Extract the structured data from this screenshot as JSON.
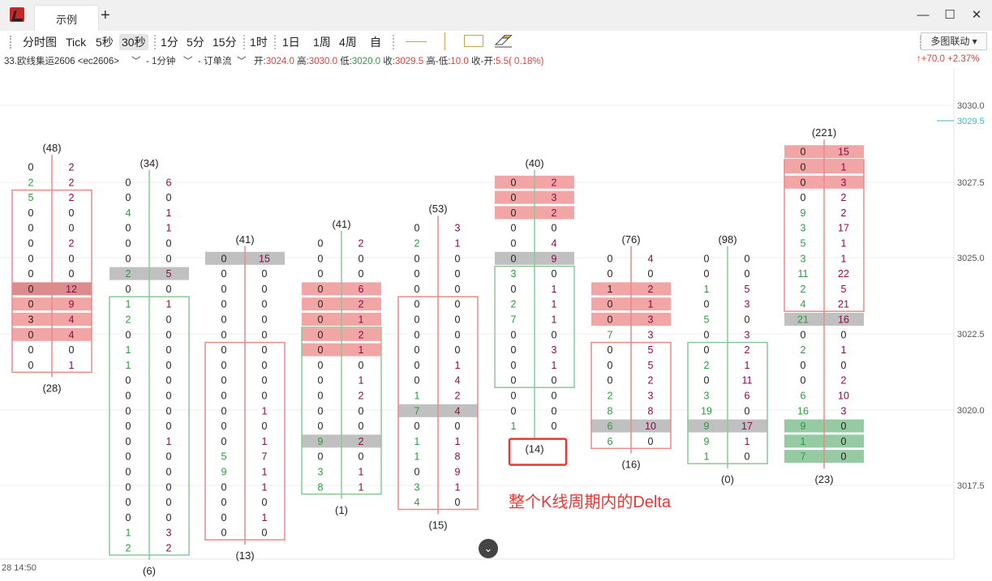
{
  "window": {
    "tab_title": "示例",
    "add_tab": "+",
    "controls": [
      "minimize",
      "maximize",
      "close"
    ]
  },
  "toolbar": {
    "items": [
      "分时图",
      "Tick",
      "5秒",
      "30秒",
      "1分",
      "5分",
      "15分",
      "1时",
      "1日",
      "1周",
      "4周",
      "自"
    ],
    "active": "30秒",
    "sync_label": "多图联动"
  },
  "info": {
    "contract": "33.欧线集运2606 <ec2606>",
    "period": "- 1分钟",
    "mode": "- 订单流",
    "open_label": "开:",
    "open": "3024.0",
    "high_label": "高:",
    "high": "3030.0",
    "low_label": "低:",
    "low": "3020.0",
    "close_label": "收:",
    "close": "3029.5",
    "hl_label": "高-低:",
    "hl": "10.0",
    "co_label": "收-开:",
    "co": "5.5( 0.18%)",
    "change": "↑+70.0 +2.37%"
  },
  "colors": {
    "up": "#e0403a",
    "down": "#2a9d3a",
    "bid": "#222222",
    "ask": "#8b0a4a",
    "box_up": "#e88a8a",
    "box_down": "#8cc79a",
    "hl_red": "#f0a0a0",
    "hl_green": "#8fc79e",
    "hl_gray": "#bdbdbd"
  },
  "chart_data": {
    "type": "footprint",
    "price_axis": {
      "ticks": [
        "3030.0",
        "3027.5",
        "3025.0",
        "3022.5",
        "3020.0",
        "3017.5"
      ],
      "last": "3029.5"
    },
    "time_label": "28 14:50",
    "annotation": "整个K线周期内的Delta",
    "bars": [
      {
        "top_label": "(48)",
        "bottom_label": "(28)",
        "dir": "up",
        "start": 0,
        "body": [
          2,
          14
        ],
        "rows": [
          [
            0,
            2
          ],
          [
            2,
            2
          ],
          [
            5,
            2
          ],
          [
            0,
            0
          ],
          [
            0,
            0
          ],
          [
            0,
            2
          ],
          [
            0,
            0
          ],
          [
            0,
            0
          ],
          [
            0,
            12
          ],
          [
            0,
            9
          ],
          [
            3,
            4
          ],
          [
            0,
            4
          ],
          [
            0,
            0
          ],
          [
            0,
            1
          ]
        ],
        "hl": {
          "8": "d",
          "9": "r",
          "10": "r",
          "11": "r"
        }
      },
      {
        "top_label": "(34)",
        "bottom_label": "(6)",
        "dir": "down",
        "start": 1,
        "body": [
          6,
          25
        ],
        "rows": [
          [
            0,
            6
          ],
          [
            0,
            0
          ],
          [
            4,
            1
          ],
          [
            0,
            1
          ],
          [
            0,
            0
          ],
          [
            0,
            0
          ],
          [
            2,
            5
          ],
          [
            0,
            0
          ],
          [
            1,
            1
          ],
          [
            2,
            0
          ],
          [
            0,
            0
          ],
          [
            1,
            0
          ],
          [
            1,
            0
          ],
          [
            0,
            0
          ],
          [
            0,
            0
          ],
          [
            0,
            0
          ],
          [
            0,
            0
          ],
          [
            0,
            1
          ],
          [
            0,
            0
          ],
          [
            0,
            0
          ],
          [
            0,
            0
          ],
          [
            0,
            0
          ],
          [
            0,
            0
          ],
          [
            1,
            3
          ],
          [
            2,
            2
          ]
        ],
        "hl": {
          "6": "g"
        }
      },
      {
        "top_label": "(41)",
        "bottom_label": "(13)",
        "dir": "up",
        "start": 6,
        "body": [
          6,
          25
        ],
        "rows": [
          [
            0,
            15
          ],
          [
            0,
            0
          ],
          [
            0,
            0
          ],
          [
            0,
            0
          ],
          [
            0,
            0
          ],
          [
            0,
            0
          ],
          [
            0,
            0
          ],
          [
            0,
            0
          ],
          [
            0,
            0
          ],
          [
            0,
            0
          ],
          [
            0,
            1
          ],
          [
            0,
            0
          ],
          [
            0,
            1
          ],
          [
            5,
            7
          ],
          [
            9,
            1
          ],
          [
            0,
            1
          ],
          [
            0,
            0
          ],
          [
            0,
            1
          ],
          [
            0,
            0
          ]
        ],
        "hl": {
          "0": "g"
        }
      },
      {
        "top_label": "(41)",
        "bottom_label": "(1)",
        "dir": "down",
        "start": 5,
        "body": [
          6,
          22
        ],
        "rows": [
          [
            0,
            2
          ],
          [
            0,
            0
          ],
          [
            0,
            0
          ],
          [
            0,
            6
          ],
          [
            0,
            2
          ],
          [
            0,
            1
          ],
          [
            0,
            2
          ],
          [
            0,
            1
          ],
          [
            0,
            0
          ],
          [
            0,
            1
          ],
          [
            0,
            2
          ],
          [
            0,
            0
          ],
          [
            0,
            0
          ],
          [
            9,
            2
          ],
          [
            0,
            0
          ],
          [
            3,
            1
          ],
          [
            8,
            1
          ]
        ],
        "hl": {
          "3": "r",
          "4": "r",
          "5": "r",
          "6": "r",
          "7": "r",
          "13": "g"
        }
      },
      {
        "top_label": "(53)",
        "bottom_label": "(15)",
        "dir": "up",
        "start": 4,
        "body": [
          5,
          21
        ],
        "rows": [
          [
            0,
            3
          ],
          [
            2,
            1
          ],
          [
            0,
            0
          ],
          [
            0,
            0
          ],
          [
            0,
            0
          ],
          [
            0,
            0
          ],
          [
            0,
            0
          ],
          [
            0,
            0
          ],
          [
            0,
            0
          ],
          [
            0,
            1
          ],
          [
            0,
            4
          ],
          [
            1,
            2
          ],
          [
            7,
            4
          ],
          [
            0,
            0
          ],
          [
            1,
            1
          ],
          [
            1,
            8
          ],
          [
            0,
            9
          ],
          [
            3,
            1
          ],
          [
            4,
            0
          ]
        ],
        "hl": {
          "12": "g"
        }
      },
      {
        "top_label": "(40)",
        "bottom_label": "(14)",
        "dir": "down",
        "start": 1,
        "body": [
          6,
          8
        ],
        "rows": [
          [
            0,
            2
          ],
          [
            0,
            3
          ],
          [
            0,
            2
          ],
          [
            0,
            0
          ],
          [
            0,
            4
          ],
          [
            0,
            9
          ],
          [
            3,
            0
          ],
          [
            0,
            1
          ],
          [
            2,
            1
          ],
          [
            7,
            1
          ],
          [
            0,
            0
          ],
          [
            0,
            3
          ],
          [
            0,
            1
          ],
          [
            0,
            0
          ],
          [
            0,
            0
          ],
          [
            0,
            0
          ],
          [
            1,
            0
          ]
        ],
        "hl": {
          "0": "r",
          "1": "r",
          "2": "r",
          "5": "g"
        }
      },
      {
        "top_label": "(76)",
        "bottom_label": "(16)",
        "dir": "up",
        "start": 6,
        "body": [
          6,
          10
        ],
        "rows": [
          [
            0,
            4
          ],
          [
            0,
            0
          ],
          [
            1,
            2
          ],
          [
            0,
            1
          ],
          [
            0,
            3
          ],
          [
            7,
            3
          ],
          [
            0,
            5
          ],
          [
            0,
            5
          ],
          [
            0,
            2
          ],
          [
            2,
            3
          ],
          [
            8,
            8
          ],
          [
            6,
            10
          ],
          [
            6,
            0
          ]
        ],
        "hl": {
          "2": "r",
          "3": "r",
          "4": "r",
          "11": "g"
        }
      },
      {
        "top_label": "(98)",
        "bottom_label": "(0)",
        "dir": "down",
        "start": 6,
        "body": [
          6,
          8
        ],
        "rows": [
          [
            0,
            0
          ],
          [
            0,
            0
          ],
          [
            1,
            5
          ],
          [
            0,
            3
          ],
          [
            5,
            0
          ],
          [
            0,
            3
          ],
          [
            0,
            2
          ],
          [
            2,
            1
          ],
          [
            0,
            11
          ],
          [
            3,
            6
          ],
          [
            19,
            0
          ],
          [
            9,
            17
          ],
          [
            9,
            1
          ],
          [
            1,
            0
          ]
        ],
        "hl": {
          "11": "g"
        }
      },
      {
        "top_label": "(221)",
        "bottom_label": "(23)",
        "dir": "up",
        "start": -1,
        "body": [
          1,
          10
        ],
        "rows": [
          [
            0,
            15
          ],
          [
            0,
            1
          ],
          [
            0,
            3
          ],
          [
            0,
            2
          ],
          [
            9,
            2
          ],
          [
            3,
            17
          ],
          [
            5,
            1
          ],
          [
            3,
            1
          ],
          [
            11,
            22
          ],
          [
            2,
            5
          ],
          [
            4,
            21
          ],
          [
            21,
            16
          ],
          [
            0,
            0
          ],
          [
            2,
            1
          ],
          [
            0,
            0
          ],
          [
            0,
            2
          ],
          [
            6,
            10
          ],
          [
            16,
            3
          ],
          [
            9,
            0
          ],
          [
            1,
            0
          ],
          [
            7,
            0
          ]
        ],
        "hl": {
          "0": "r",
          "1": "r",
          "2": "r",
          "11": "g",
          "18": "G",
          "19": "G",
          "20": "G"
        }
      }
    ]
  }
}
